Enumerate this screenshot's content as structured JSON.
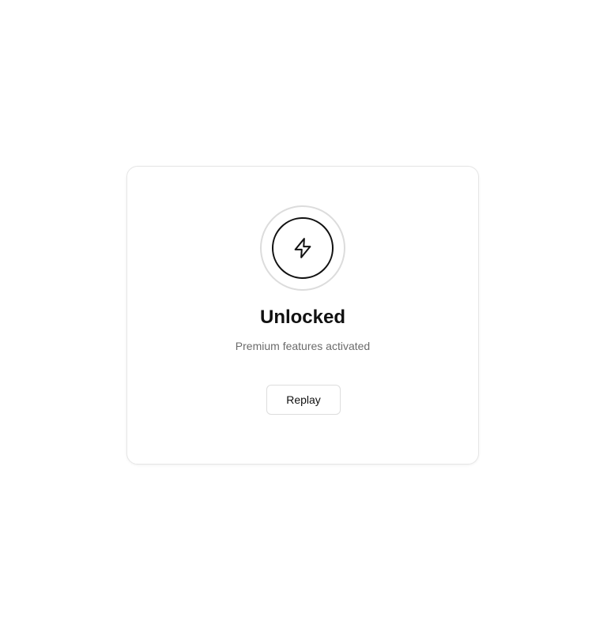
{
  "card": {
    "icon": "lightning-bolt-icon",
    "title": "Unlocked",
    "subtitle": "Premium features activated",
    "replay_label": "Replay"
  },
  "colors": {
    "background": "#ffffff",
    "card_border": "#e6e6e6",
    "ring_outer": "#dcdcdc",
    "ring_inner": "#111111",
    "title": "#111111",
    "subtitle": "#6b6b6b"
  }
}
